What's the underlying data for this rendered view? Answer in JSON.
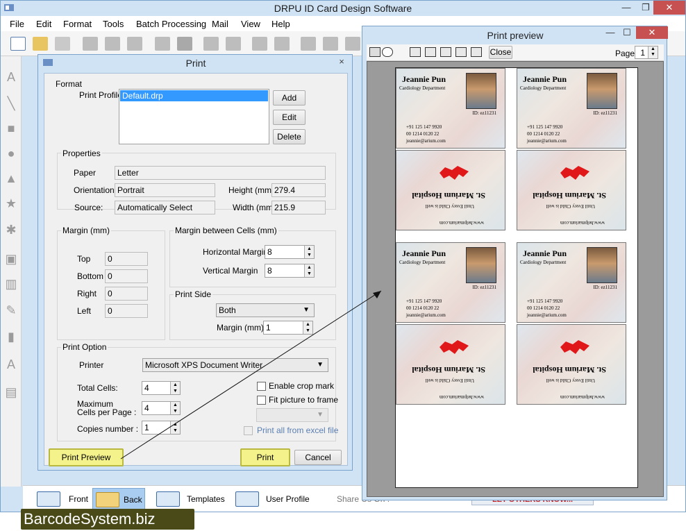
{
  "app": {
    "title": "DRPU ID Card Design Software",
    "menu": [
      "File",
      "Edit",
      "Format",
      "Tools",
      "Batch Processing",
      "Mail",
      "View",
      "Help"
    ]
  },
  "print_dialog": {
    "title": "Print",
    "close": "×",
    "format_label": "Format",
    "print_profile_label": "Print Profile",
    "profile_selected": "Default.drp",
    "add": "Add",
    "edit": "Edit",
    "delete": "Delete",
    "properties_label": "Properties",
    "paper_label": "Paper",
    "paper_value": "Letter",
    "orientation_label": "Orientation",
    "orientation_value": "Portrait",
    "height_label": "Height (mm)",
    "height_value": "279.4",
    "source_label": "Source:",
    "source_value": "Automatically Select",
    "width_label": "Width (mm)",
    "width_value": "215.9",
    "margin_label": "Margin (mm)",
    "top_label": "Top",
    "top_value": "0",
    "bottom_label": "Bottom",
    "bottom_value": "0",
    "right_label": "Right",
    "right_value": "0",
    "left_label": "Left",
    "left_value": "0",
    "cells_margin_label": "Margin between Cells (mm)",
    "hmargin_label": "Horizontal Margin",
    "hmargin_value": "8",
    "vmargin_label": "Vertical Margin",
    "vmargin_value": "8",
    "print_side_label": "Print Side",
    "print_side_value": "Both",
    "side_margin_label": "Margin (mm)",
    "side_margin_value": "1",
    "print_option_label": "Print Option",
    "printer_label": "Printer",
    "printer_value": "Microsoft XPS Document Writer",
    "total_cells_label": "Total Cells:",
    "total_cells_value": "4",
    "max_cells_label_1": "Maximum",
    "max_cells_label_2": "Cells per Page :",
    "max_cells_value": "4",
    "copies_label": "Copies number :",
    "copies_value": "1",
    "crop_mark": "Enable crop mark",
    "fit_picture": "Fit picture to frame",
    "print_all_excel": "Print all from excel file",
    "print_preview": "Print Preview",
    "print": "Print",
    "cancel": "Cancel"
  },
  "preview": {
    "title": "Print preview",
    "close": "Close",
    "page_label": "Page",
    "page_value": "1",
    "card": {
      "name": "Jeannie Pun",
      "dept": "Cardiology Department",
      "id": "ID: ez11231",
      "phone1": "+91 125 147 9920",
      "phone2": "00 1214 0120 22",
      "email": "jeannie@arium.com",
      "hospital": "St. Marium Hospital",
      "tagline": "Until Every Child is well",
      "url": "www.helpmarium.com"
    }
  },
  "bottom": {
    "front": "Front",
    "back": "Back",
    "templates": "Templates",
    "user_profile": "User Profile",
    "share": "Share Us On :",
    "let_others": "LET OTHERS KNOW..."
  },
  "brand": "BarcodeSystem.biz"
}
